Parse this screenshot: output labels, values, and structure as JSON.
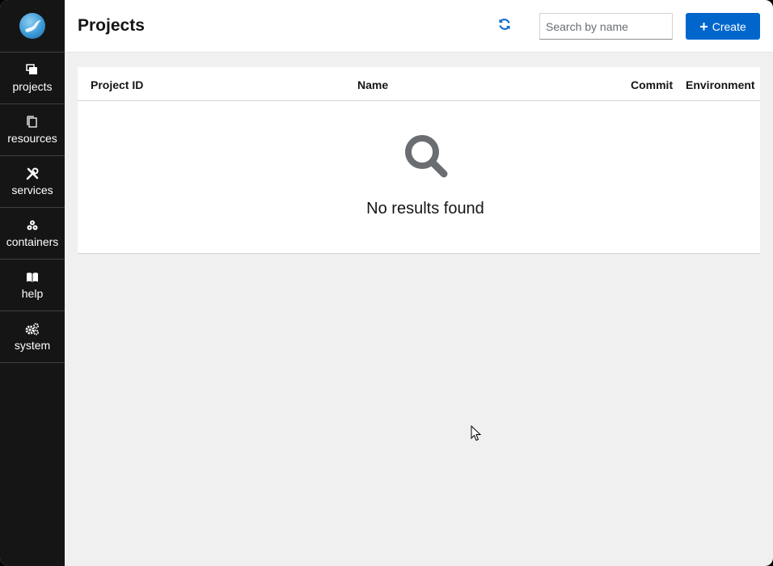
{
  "sidebar": {
    "items": [
      {
        "label": "projects",
        "icon": "projects-icon"
      },
      {
        "label": "resources",
        "icon": "resources-icon"
      },
      {
        "label": "services",
        "icon": "services-icon"
      },
      {
        "label": "containers",
        "icon": "containers-icon"
      },
      {
        "label": "help",
        "icon": "help-book-icon"
      },
      {
        "label": "system",
        "icon": "system-gears-icon"
      }
    ]
  },
  "header": {
    "title": "Projects",
    "search_placeholder": "Search by name",
    "create_label": "Create"
  },
  "table": {
    "columns": [
      "Project ID",
      "Name",
      "Commit",
      "Environment"
    ],
    "rows": [],
    "empty_message": "No results found"
  },
  "colors": {
    "sidebar_bg": "#151515",
    "accent": "#0066cc",
    "page_bg": "#f0f0f0"
  }
}
